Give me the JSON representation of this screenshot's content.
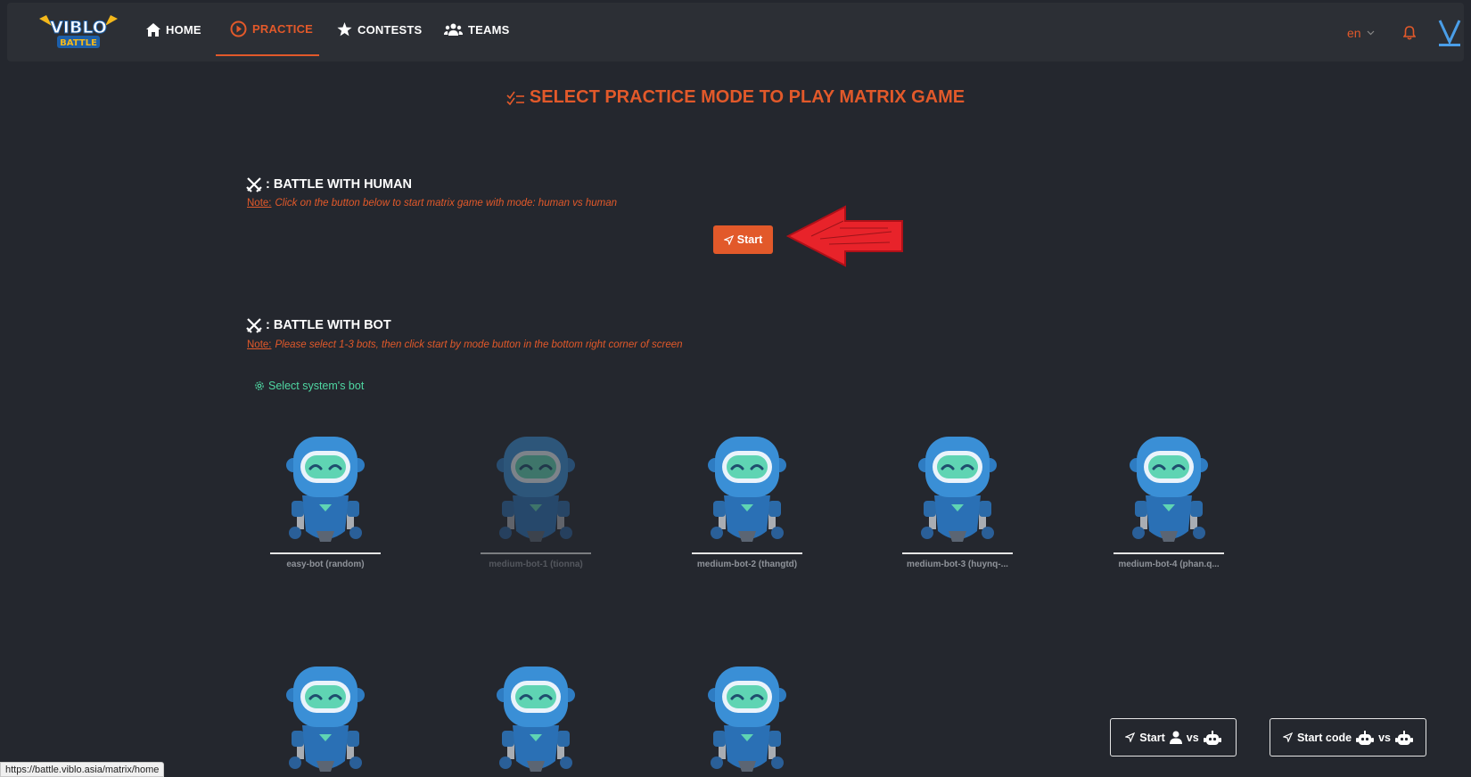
{
  "app": {
    "logo_top": "VIBLO",
    "logo_bottom": "BATTLE",
    "nav": [
      {
        "label": "HOME",
        "icon": "home-icon"
      },
      {
        "label": "PRACTICE",
        "icon": "play-circle-icon",
        "active": true
      },
      {
        "label": "CONTESTS",
        "icon": "star-icon"
      },
      {
        "label": "TEAMS",
        "icon": "users-icon"
      }
    ],
    "language": "en",
    "accent_color": "#e2592a",
    "green_color": "#4fd6a2"
  },
  "main": {
    "title": "SELECT PRACTICE MODE TO PLAY MATRIX GAME",
    "human": {
      "heading": ": BATTLE WITH HUMAN",
      "note_label": "Note:",
      "note_text": "Click on the button below to start matrix game with mode: human vs human",
      "start_label": "Start"
    },
    "bot": {
      "heading": ": BATTLE WITH BOT",
      "note_label": "Note:",
      "note_text": "Please select 1-3 bots, then click start by mode button in the bottom right corner of screen",
      "select_label": "Select system's bot",
      "bots": [
        {
          "name": "easy-bot (random)"
        },
        {
          "name": "medium-bot-1 (tionna)",
          "dimmed": true
        },
        {
          "name": "medium-bot-2 (thangtd)"
        },
        {
          "name": "medium-bot-3 (huynq-..."
        },
        {
          "name": "medium-bot-4 (phan.q..."
        },
        {
          "name": ""
        },
        {
          "name": ""
        },
        {
          "name": ""
        }
      ]
    }
  },
  "actions": {
    "start_human_vs_bot": {
      "start": "Start",
      "vs": "vs"
    },
    "start_code_vs_bot": {
      "start": "Start code",
      "vs": "vs"
    }
  },
  "status_url": "https://battle.viblo.asia/matrix/home"
}
